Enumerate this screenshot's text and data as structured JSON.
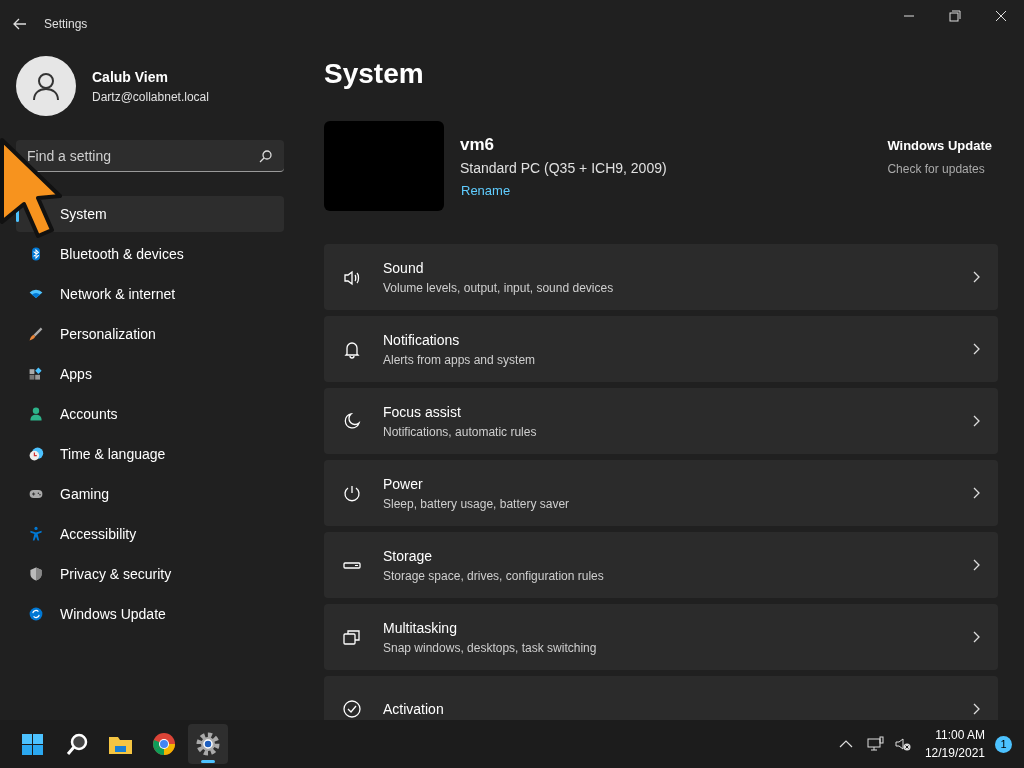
{
  "window": {
    "title": "Settings"
  },
  "user": {
    "name": "Calub Viem",
    "email": "Dartz@collabnet.local"
  },
  "search": {
    "placeholder": "Find a setting"
  },
  "nav": [
    {
      "label": "System",
      "selected": true
    },
    {
      "label": "Bluetooth & devices",
      "selected": false
    },
    {
      "label": "Network & internet",
      "selected": false
    },
    {
      "label": "Personalization",
      "selected": false
    },
    {
      "label": "Apps",
      "selected": false
    },
    {
      "label": "Accounts",
      "selected": false
    },
    {
      "label": "Time & language",
      "selected": false
    },
    {
      "label": "Gaming",
      "selected": false
    },
    {
      "label": "Accessibility",
      "selected": false
    },
    {
      "label": "Privacy & security",
      "selected": false
    },
    {
      "label": "Windows Update",
      "selected": false
    }
  ],
  "page_title": "System",
  "device": {
    "name": "vm6",
    "model": "Standard PC (Q35 + ICH9, 2009)",
    "rename": "Rename"
  },
  "update": {
    "title": "Windows Update",
    "subtitle": "Check for updates"
  },
  "cards": [
    {
      "title": "Sound",
      "description": "Volume levels, output, input, sound devices"
    },
    {
      "title": "Notifications",
      "description": "Alerts from apps and system"
    },
    {
      "title": "Focus assist",
      "description": "Notifications, automatic rules"
    },
    {
      "title": "Power",
      "description": "Sleep, battery usage, battery saver"
    },
    {
      "title": "Storage",
      "description": "Storage space, drives, configuration rules"
    },
    {
      "title": "Multitasking",
      "description": "Snap windows, desktops, task switching"
    },
    {
      "title": "Activation"
    }
  ],
  "taskbar": {
    "apps": [
      {
        "kind": "start",
        "selected": false
      },
      {
        "kind": "search",
        "selected": false
      },
      {
        "kind": "explorer",
        "selected": false
      },
      {
        "kind": "chrome",
        "selected": false
      },
      {
        "kind": "settings",
        "selected": true
      }
    ],
    "time": "11:00 AM",
    "date": "12/19/2021",
    "badge": "1"
  }
}
